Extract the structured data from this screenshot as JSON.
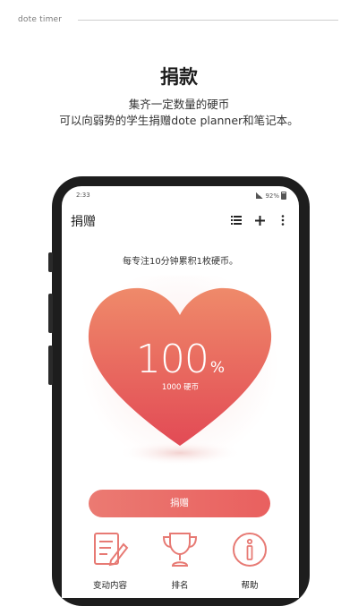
{
  "header": {
    "brand": "dote timer"
  },
  "hero": {
    "title": "捐款",
    "subtitle_line1": "集齐一定数量的硬币",
    "subtitle_line2": "可以向弱势的学生捐赠dote planner和笔记本。"
  },
  "phone": {
    "status": {
      "time": "2:33",
      "battery": "92%"
    },
    "appbar": {
      "title": "捐赠"
    },
    "hint": "每专注10分钟累积1枚硬币。",
    "heart": {
      "value": "100",
      "unit": "%",
      "coins": "1000 硬币"
    },
    "donate_button": "捐赠",
    "nav": [
      {
        "label": "变动内容",
        "icon": "edit-document-icon"
      },
      {
        "label": "排名",
        "icon": "trophy-icon"
      },
      {
        "label": "帮助",
        "icon": "info-icon"
      }
    ]
  },
  "colors": {
    "accent": "#e9605f",
    "heart_top": "#ef8a6a",
    "heart_bottom": "#e24a55"
  }
}
